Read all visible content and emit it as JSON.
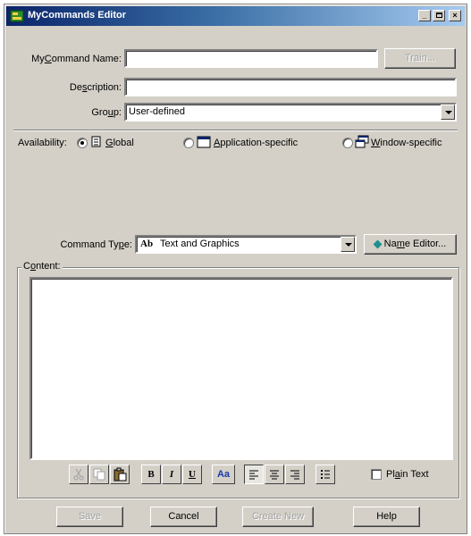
{
  "window": {
    "title": "MyCommands Editor"
  },
  "form": {
    "name_label_pre": "My",
    "name_label_acc": "C",
    "name_label_post": "ommand Name:",
    "name_value": "",
    "train_label": "Train...",
    "desc_label_pre": "De",
    "desc_label_acc": "s",
    "desc_label_post": "cription:",
    "desc_value": "",
    "group_label_pre": "Gro",
    "group_label_acc": "u",
    "group_label_post": "p:",
    "group_value": "User-defined"
  },
  "availability": {
    "label": "Availability:",
    "options": [
      {
        "pre": "",
        "acc": "G",
        "post": "lobal",
        "selected": true
      },
      {
        "pre": "",
        "acc": "A",
        "post": "pplication-specific",
        "selected": false
      },
      {
        "pre": "",
        "acc": "W",
        "post": "indow-specific",
        "selected": false
      }
    ]
  },
  "command_type": {
    "label_pre": "Command Ty",
    "label_acc": "p",
    "label_post": "e:",
    "value": "Text and Graphics",
    "icon_text": "Ab",
    "name_editor_pre": "Na",
    "name_editor_acc": "m",
    "name_editor_post": "e Editor..."
  },
  "content": {
    "label_pre": "C",
    "label_acc": "o",
    "label_post": "ntent:",
    "text": ""
  },
  "toolbar": {
    "bold": "B",
    "italic": "I",
    "underline": "U",
    "font": "Aa",
    "plain_text_pre": "Pl",
    "plain_text_acc": "a",
    "plain_text_post": "in Text"
  },
  "buttons": {
    "save": "Save",
    "cancel": "Cancel",
    "create_new": "Create New",
    "help": "Help"
  },
  "colors": {
    "title_bar_start": "#0a246a",
    "title_bar_end": "#a6caf0",
    "face": "#d4d0c8"
  }
}
